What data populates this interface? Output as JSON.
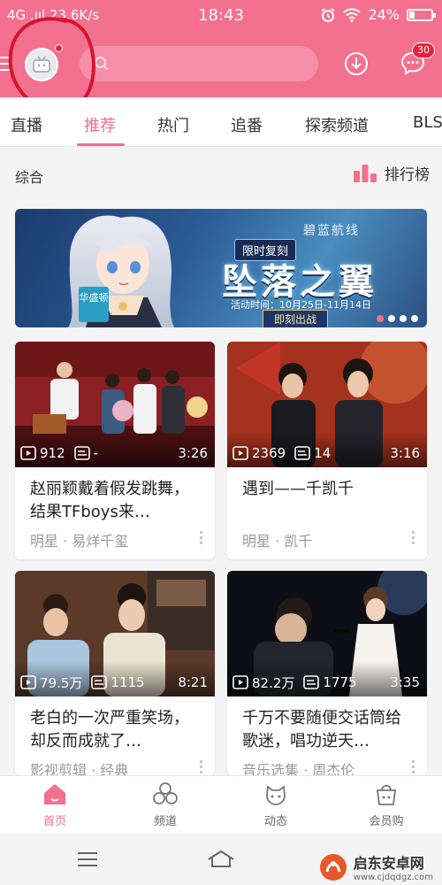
{
  "status_bar": {
    "network": "4G .ııl 23.6K/s",
    "time": "18:43",
    "battery": "24%",
    "battery_level": 0.24
  },
  "header": {
    "search_placeholder": "",
    "message_count": "30"
  },
  "tabs": [
    {
      "label": "直播",
      "active": false
    },
    {
      "label": "推荐",
      "active": true
    },
    {
      "label": "热门",
      "active": false
    },
    {
      "label": "追番",
      "active": false
    },
    {
      "label": "探索频道",
      "active": false
    },
    {
      "label": "BLS",
      "active": false
    }
  ],
  "section": {
    "title": "综合",
    "ranking_label": "排行榜"
  },
  "banner": {
    "tag": "限时复刻",
    "game": "碧蓝航线",
    "title": "坠落之翼",
    "date": "活动时间：10月25日-11月14日",
    "cta": "即刻出战",
    "badge": "华盛顿",
    "dot_count": 4,
    "active_dot": 0
  },
  "cards": [
    {
      "views": "912",
      "danmaku": "-",
      "duration": "3:26",
      "title": "赵丽颖戴着假发跳舞，结果TFboys来…",
      "tags": "明星 · 易烊千玺"
    },
    {
      "views": "2369",
      "danmaku": "14",
      "duration": "3:16",
      "title": "遇到——千凯千",
      "tags": "明星 · 凯千"
    },
    {
      "views": "79.5万",
      "danmaku": "1115",
      "duration": "8:21",
      "title": "老白的一次严重笑场，却反而成就了…",
      "tags": "影视剪辑 · 经典"
    },
    {
      "views": "82.2万",
      "danmaku": "1775",
      "duration": "3:35",
      "title": "千万不要随便交话筒给歌迷，唱功逆天…",
      "tags": "音乐选集 · 周杰伦"
    }
  ],
  "bottom_nav": [
    {
      "label": "首页",
      "icon": "home-icon",
      "active": true
    },
    {
      "label": "频道",
      "icon": "channels-icon",
      "active": false
    },
    {
      "label": "动态",
      "icon": "dynamics-icon",
      "active": false
    },
    {
      "label": "会员购",
      "icon": "shop-icon",
      "active": false
    }
  ],
  "watermark": {
    "name": "启东安卓网",
    "url": "www.cjdqdgz.com"
  },
  "colors": {
    "brand_pink": "#f3708f",
    "badge_red": "#e8213a"
  }
}
